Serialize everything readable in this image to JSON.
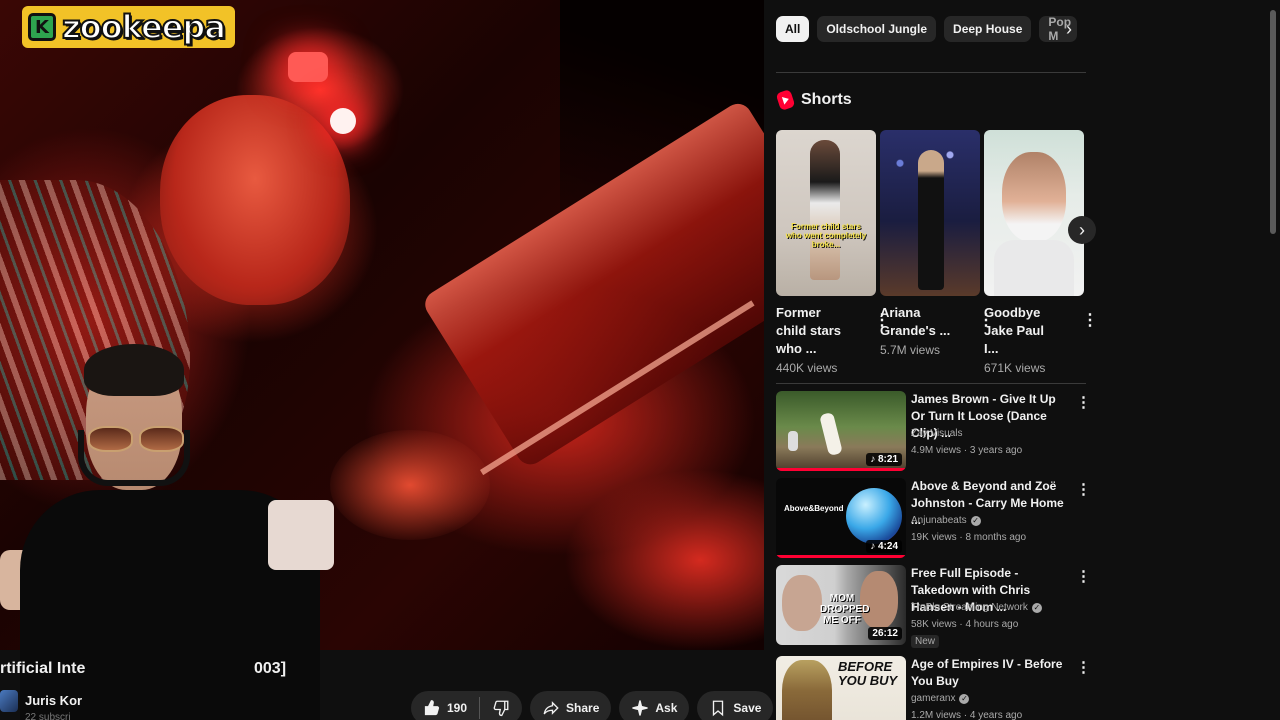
{
  "logo": {
    "mark": "K",
    "text": "zookeepa"
  },
  "video": {
    "title_visible": "rtificial Inte",
    "title_end": "003]",
    "channel": "Juris Kor",
    "subscribers": "22 subscri",
    "likes": "190",
    "actions": {
      "share": "Share",
      "ask": "Ask",
      "save": "Save",
      "more": "⋯"
    }
  },
  "chips": [
    "All",
    "Oldschool Jungle",
    "Deep House",
    "Pop M"
  ],
  "shorts": {
    "title": "Shorts",
    "items": [
      {
        "title": "Former child stars who ...",
        "views": "440K views",
        "caption": "Former child stars who went completely broke..."
      },
      {
        "title": "Ariana Grande's ...",
        "views": "5.7M views"
      },
      {
        "title": "Goodbye Jake Paul I...",
        "views": "671K views"
      }
    ]
  },
  "recommendations": [
    {
      "title": "James Brown - Give It Up Or Turn It Loose (Dance Clip) ...",
      "channel": "Zay Visuals",
      "verified": false,
      "meta": "4.9M views · 3 years ago",
      "duration": "8:21",
      "progress": 1.0
    },
    {
      "title": "Above & Beyond and Zoë Johnston - Carry Me Home ...",
      "channel": "Anjunabeats",
      "verified": true,
      "meta": "19K views · 8 months ago",
      "duration": "4:24",
      "progress": 1.0,
      "thumb_text": "Above&Beyond"
    },
    {
      "title": "Free Full Episode - Takedown with Chris Hansen - Mom ...",
      "channel": "TruBlu Streaming Network",
      "verified": true,
      "meta": "58K views · 4 hours ago",
      "duration": "26:12",
      "badge": "New",
      "thumb_text": "MOM DROPPED ME OFF"
    },
    {
      "title": "Age of Empires IV - Before You Buy",
      "channel": "gameranx",
      "verified": true,
      "meta": "1.2M views · 4 years ago",
      "thumb_text": "BEFORE YOU BUY"
    }
  ],
  "icons": {
    "like": "thumbs-up-icon",
    "dislike": "thumbs-down-icon",
    "share": "share-icon",
    "ask": "sparkle-icon",
    "save": "bookmark-icon",
    "more": "more-horizontal-icon",
    "chips_next": "chevron-right-icon",
    "shorts": "shorts-logo-icon",
    "kebab": "kebab-menu-icon"
  },
  "colors": {
    "background": "#0f0f0f",
    "chip": "#272727",
    "accent": "#ff0033",
    "logo": "#f2c227"
  }
}
